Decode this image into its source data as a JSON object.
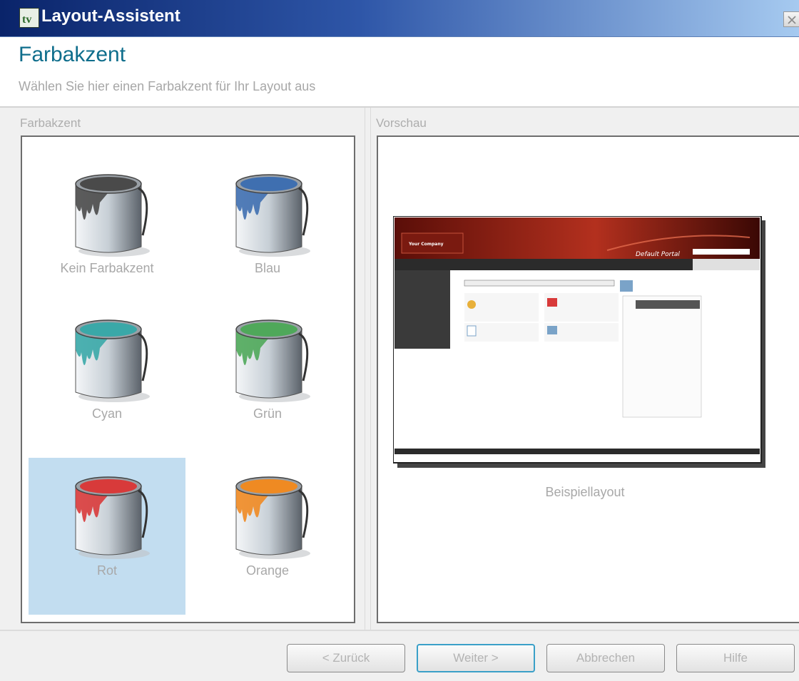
{
  "window": {
    "title": "Layout-Assistent"
  },
  "header": {
    "title": "Farbakzent",
    "subtitle": "Wählen Sie hier einen Farbakzent für Ihr Layout aus"
  },
  "left_group": {
    "label": "Farbakzent"
  },
  "right_group": {
    "label": "Vorschau"
  },
  "swatches": [
    {
      "label": "Kein Farbakzent",
      "color": "#4a4a4a",
      "selected": false
    },
    {
      "label": "Blau",
      "color": "#3f6fb0",
      "selected": false
    },
    {
      "label": "Cyan",
      "color": "#3aa8a8",
      "selected": false
    },
    {
      "label": "Grün",
      "color": "#4fa85a",
      "selected": false
    },
    {
      "label": "Rot",
      "color": "#d83a3a",
      "selected": true
    },
    {
      "label": "Orange",
      "color": "#ef8a22",
      "selected": false
    }
  ],
  "preview": {
    "label": "Beispiellayout",
    "company": "Your Company",
    "portal": "Default Portal"
  },
  "buttons": {
    "back": "< Zurück",
    "next": "Weiter >",
    "cancel": "Abbrechen",
    "help": "Hilfe"
  },
  "colors": {
    "title_accent": "#0f6e8c",
    "selection": "#c2ddf0"
  },
  "icons": {
    "app": "application-icon",
    "close": "close-icon",
    "bucket": "paint-bucket-icon"
  }
}
